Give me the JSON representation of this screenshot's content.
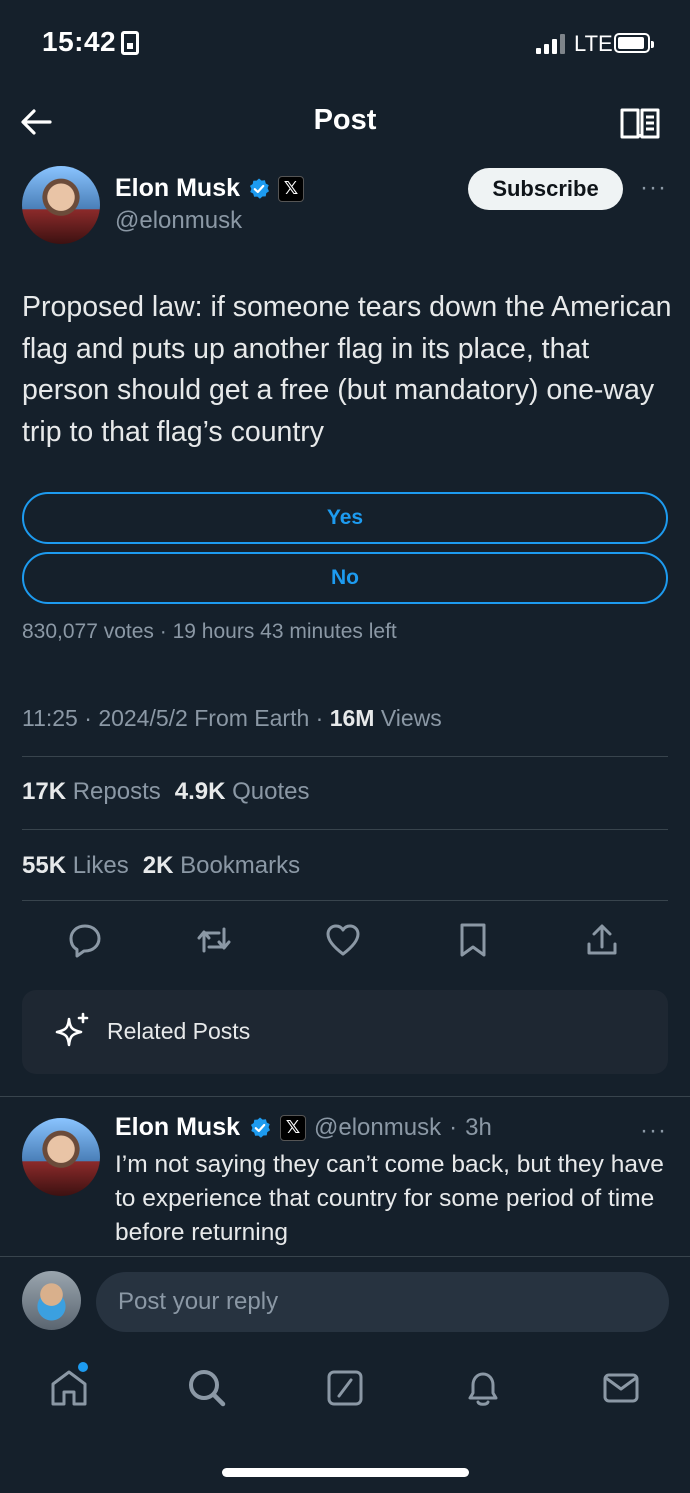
{
  "status_bar": {
    "time": "15:42",
    "network": "LTE"
  },
  "nav": {
    "title": "Post"
  },
  "post": {
    "author_name": "Elon Musk",
    "handle": "@elonmusk",
    "subscribe_label": "Subscribe",
    "more": "···",
    "text": "Proposed law: if someone tears down the American flag and puts up another flag in its place, that person should get a free (but mandatory) one-way trip to that flag’s country",
    "poll": {
      "options": [
        "Yes",
        "No"
      ],
      "votes": "830,077 votes",
      "time_left": "19 hours 43 minutes left"
    },
    "time": "11:25",
    "date": "2024/5/2",
    "source": "From Earth",
    "views_count": "16M",
    "views_label": "Views",
    "reposts_count": "17K",
    "reposts_label": "Reposts",
    "quotes_count": "4.9K",
    "quotes_label": "Quotes",
    "likes_count": "55K",
    "likes_label": "Likes",
    "bookmarks_count": "2K",
    "bookmarks_label": "Bookmarks"
  },
  "related": {
    "label": "Related Posts"
  },
  "reply": {
    "author_name": "Elon Musk",
    "handle": "@elonmusk",
    "age": "3h",
    "text": "I’m not saying they can’t come back, but they have to experience that country for some period of time before returning"
  },
  "composer": {
    "placeholder": "Post your reply"
  },
  "tabs": [
    "home-icon",
    "search-icon",
    "grok-icon",
    "notifications-icon",
    "messages-icon"
  ],
  "colors": {
    "background": "#15202b",
    "accent": "#1d9bf0",
    "muted": "#8b98a5"
  }
}
